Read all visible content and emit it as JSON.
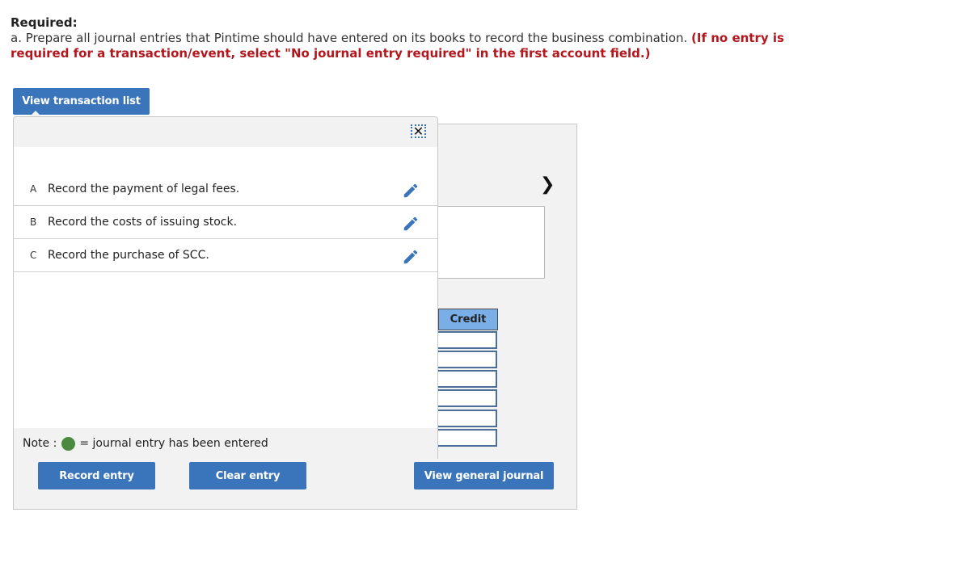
{
  "header": {
    "required_label": "Required:",
    "instruction_text": "a. Prepare all journal entries that Pintime should have entered on its books to record the business combination. ",
    "instruction_note": "(If no entry is required for a transaction/event, select \"No journal entry required\" in the first account field.)"
  },
  "buttons": {
    "view_transaction_list": "View transaction list",
    "record_entry": "Record entry",
    "clear_entry": "Clear entry",
    "view_general_journal": "View general journal"
  },
  "popover": {
    "close_icon": "close-icon",
    "transactions": [
      {
        "letter": "A",
        "text": "Record the payment of legal fees.",
        "icon": "pencil-icon"
      },
      {
        "letter": "B",
        "text": "Record the costs of issuing stock.",
        "icon": "pencil-icon"
      },
      {
        "letter": "C",
        "text": "Record the purchase of SCC.",
        "icon": "pencil-icon"
      }
    ],
    "note": {
      "label": "Note :",
      "text": "= journal entry has been entered",
      "dot_color": "#4a8a3e"
    }
  },
  "journal": {
    "next_icon": "chevron-right-icon",
    "credit_header": "Credit",
    "credit_values": [
      "",
      "",
      "",
      "",
      "",
      ""
    ]
  },
  "colors": {
    "accent": "#3a75bb",
    "warning_text": "#b2171d",
    "credit_header_bg": "#7aaee6"
  }
}
